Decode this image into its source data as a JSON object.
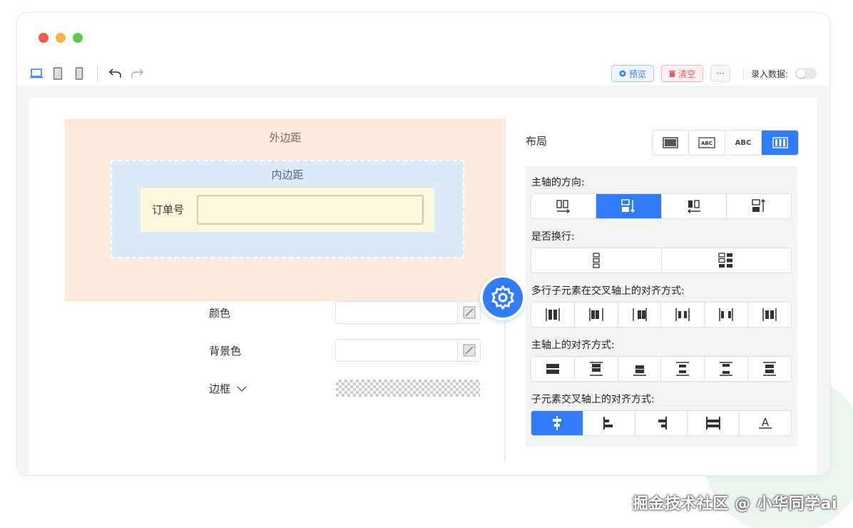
{
  "toolbar": {
    "preview_label": "预览",
    "clear_label": "清空",
    "more_label": "···",
    "record_label": "录入数据:"
  },
  "canvas": {
    "margin_label": "外边距",
    "padding_label": "内边距",
    "field_label": "订单号",
    "field_value": ""
  },
  "props": {
    "color_label": "颜色",
    "bg_color_label": "背景色",
    "border_label": "边框"
  },
  "layout": {
    "label": "布局",
    "options": [
      "block",
      "inline-block",
      "inline",
      "flex"
    ],
    "selected": "flex",
    "abc_label": "ABC"
  },
  "flex": {
    "direction_label": "主轴的方向:",
    "direction_selected": 1,
    "wrap_label": "是否换行:",
    "align_content_label": "多行子元素在交叉轴上的对齐方式:",
    "justify_label": "主轴上的对齐方式:",
    "align_items_label": "子元素交叉轴上的对齐方式:",
    "align_items_selected": 0
  },
  "colors": {
    "accent": "#2f7cf6",
    "margin_bg": "#fcebdc",
    "padding_bg": "#dbeaf8",
    "content_bg": "#fdf7db"
  },
  "watermark": "掘金技术社区 @ 小华同学ai"
}
